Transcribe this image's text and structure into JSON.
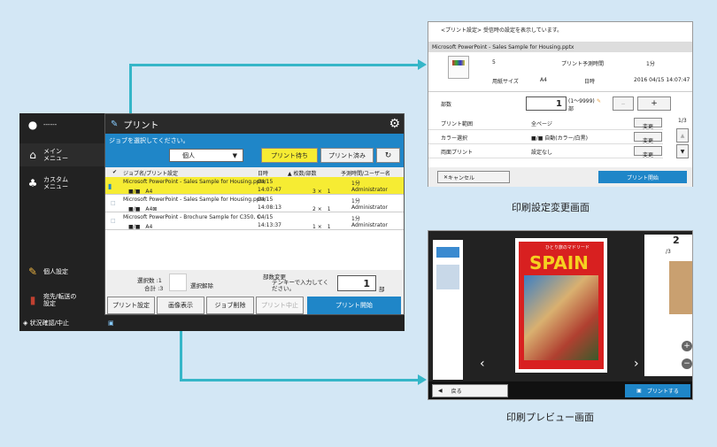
{
  "side": {
    "user_name": "------",
    "menu_main": "メイン\nメニュー",
    "menu_custom": "カスタム\nメニュー",
    "personal": "個人設定",
    "dest": "宛先/転送の\n設定",
    "status": "状況確認/中止"
  },
  "main": {
    "title": "プリント",
    "prompt": "ジョブを選択してください。",
    "filter": "個人",
    "tab_waiting": "プリント待ち",
    "tab_done": "プリント済み",
    "headers": {
      "name": "ジョブ名/プリント設定",
      "date": "日時",
      "copies": "▲ 枚数/部数",
      "time_user": "予測時間/ユーザー名"
    },
    "jobs": [
      {
        "name": "Microsoft PowerPoint - Sales Sample for Housing.pptx",
        "sub": "■/■　A4",
        "date": "04/15",
        "time": "14:07:47",
        "count": "3 ×　1",
        "est": "1分",
        "user": "Administrator"
      },
      {
        "name": "Microsoft PowerPoint - Sales Sample for Housing.pptx",
        "sub": "■/■　A4⊠",
        "date": "04/15",
        "time": "14:08:13",
        "count": "2 ×　1",
        "est": "1分",
        "user": "Administrator"
      },
      {
        "name": "Microsoft PowerPoint - Brochure Sample for C350, C.",
        "sub": "■/■　A4",
        "date": "04/15",
        "time": "14:13:37",
        "count": "1 ×　1",
        "est": "1分",
        "user": "Administrator"
      }
    ],
    "sel_count": "選択数 :1",
    "total": "合計 :3",
    "clear": "選択解除",
    "copies_change": "部数変更",
    "tenkey": "テンキーで入力してく\nださい。",
    "copies": "1",
    "copies_unit": "部",
    "btn_settings": "プリント設定",
    "btn_preview": "画像表示",
    "btn_delete": "ジョブ削除",
    "btn_stop": "プリント中止",
    "btn_start": "プリント開始"
  },
  "settings": {
    "note": "<プリント設定>  受信時の設定を表示しています。",
    "file": "Microsoft PowerPoint - Sales Sample for Housing.pptx",
    "pages": "5",
    "est_label": "プリント予測時間",
    "est_val": "1分",
    "paper_label": "用紙サイズ",
    "paper_val": "A4",
    "date_label": "日時",
    "date_val": "2016 04/15 14:07:47",
    "copies_label": "部数",
    "copies_val": "1",
    "copies_range": "(1〜9999)",
    "copies_unit": "部",
    "rows": [
      {
        "label": "プリント範囲",
        "value": "全ページ",
        "change": "変更"
      },
      {
        "label": "カラー選択",
        "value": "■/■  自動(カラー/白黒)",
        "change": "変更"
      },
      {
        "label": "両面プリント",
        "value": "設定なし",
        "change": "変更"
      }
    ],
    "page_ind": "1/3",
    "cancel": "キャンセル",
    "start": "プリント開始"
  },
  "cap_settings": "印刷設定変更画面",
  "preview": {
    "page_num": "2",
    "page_total": "/3",
    "book_title": "SPAIN",
    "book_top": "ひとり旅のマドリード",
    "back": "戻る",
    "print": "プリントする"
  },
  "cap_preview": "印刷プレビュー画面",
  "colors": {
    "accent": "#1f86c8",
    "highlight": "#f6ec33",
    "connector": "#35b6c8"
  }
}
